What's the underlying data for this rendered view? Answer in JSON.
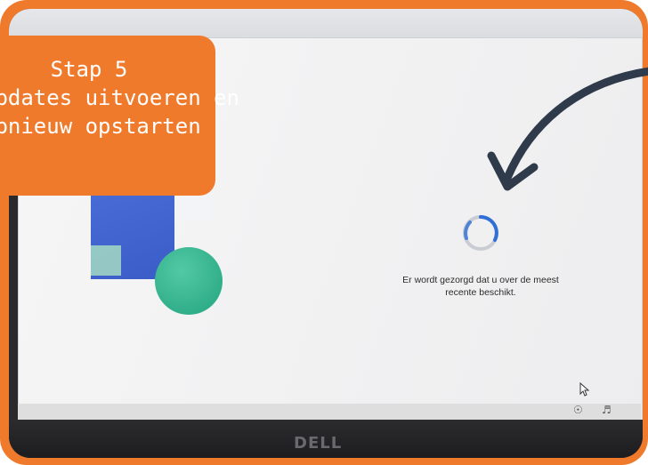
{
  "banner": {
    "line1": "Stap 5",
    "line2": "updates uitvoeren en",
    "line3": "opnieuw opstarten"
  },
  "screen": {
    "status_line1": "Er wordt gezorgd dat u over de meest",
    "status_line2": "recente beschikt."
  },
  "device": {
    "brand_label": "DELL"
  },
  "colors": {
    "accent_orange": "#f07a2c",
    "arrow": "#2f3a4a",
    "spinner": "#2f6fd6"
  },
  "icons": {
    "spinner": "loading-spinner-icon",
    "arrow": "pointer-arrow-icon",
    "cursor": "mouse-cursor-icon",
    "accessibility": "accessibility-icon",
    "volume": "volume-icon"
  }
}
